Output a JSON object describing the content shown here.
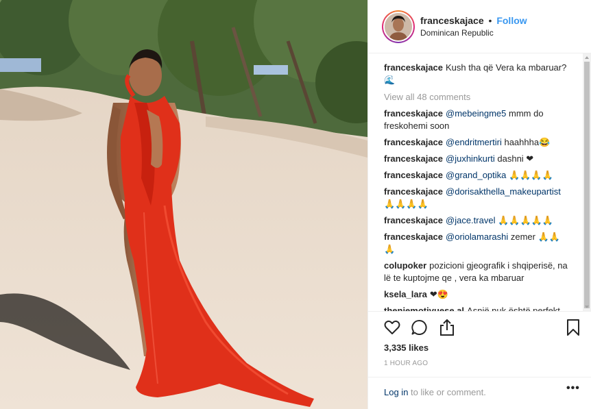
{
  "header": {
    "username": "franceskajace",
    "separator": "•",
    "follow_label": "Follow",
    "location": "Dominican Republic"
  },
  "caption": {
    "username": "franceskajace",
    "text": "Kush tha që Vera ka mbaruar? 🌊"
  },
  "view_all_comments": "View all 48 comments",
  "comments": [
    {
      "username": "franceskajace",
      "mention": "@mebeingme5",
      "text": "mmm do freskohemi soon"
    },
    {
      "username": "franceskajace",
      "mention": "@endritmertiri",
      "text": "haahhha😂"
    },
    {
      "username": "franceskajace",
      "mention": "@juxhinkurti",
      "text": "dashni ❤"
    },
    {
      "username": "franceskajace",
      "mention": "@grand_optika",
      "text": "🙏🙏🙏🙏"
    },
    {
      "username": "franceskajace",
      "mention": "@dorisakthella_makeupartist",
      "text": "🙏🙏🙏🙏"
    },
    {
      "username": "franceskajace",
      "mention": "@jace.travel",
      "text": "🙏🙏🙏🙏🙏"
    },
    {
      "username": "franceskajace",
      "mention": "@oriolamarashi",
      "text": "zemer 🙏🙏🙏"
    },
    {
      "username": "colupoker",
      "mention": "",
      "text": "pozicioni gjeografik i shqiperisë, na lë te kuptojme qe , vera ka mbaruar"
    },
    {
      "username": "ksela_lara",
      "mention": "",
      "text": "❤😍"
    },
    {
      "username": "theniemotivuese.al",
      "mention": "",
      "text": "Asnjë nuk është perfekt, por ti je dhe ajo që të bën të veçantë"
    }
  ],
  "actions": {
    "like_icon": "heart-icon",
    "comment_icon": "comment-icon",
    "share_icon": "share-icon",
    "save_icon": "bookmark-icon",
    "likes": "3,335 likes",
    "time": "1 HOUR AGO",
    "login_link": "Log in",
    "login_rest": "to like or comment.",
    "more_icon": "more-options-icon",
    "more_glyph": "•••"
  },
  "colors": {
    "follow": "#3897f0",
    "link": "#003569",
    "muted": "#999999",
    "dress": "#e8331c"
  }
}
